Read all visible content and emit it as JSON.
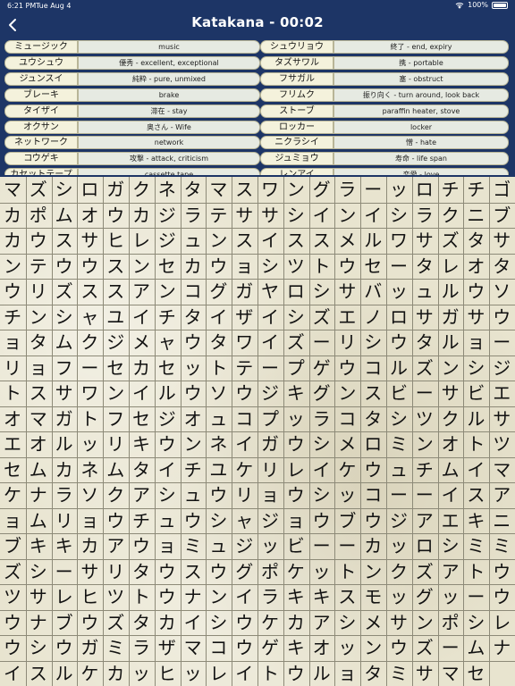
{
  "status_bar": {
    "time": "6:21 PM",
    "date": "Tue Aug 4",
    "battery": "100%"
  },
  "header": {
    "title": "Katakana - 00:02",
    "back_icon": "chevron-left-icon"
  },
  "word_list": [
    {
      "term": "ミュージック",
      "meaning": "music"
    },
    {
      "term": "シュウリョウ",
      "meaning": "終了 - end, expiry"
    },
    {
      "term": "ユウシュウ",
      "meaning": "優秀 - excellent, exceptional"
    },
    {
      "term": "タズサワル",
      "meaning": "携 - portable"
    },
    {
      "term": "ジュンスイ",
      "meaning": "純粋 - pure, unmixed"
    },
    {
      "term": "フサガル",
      "meaning": "塞 - obstruct"
    },
    {
      "term": "ブレーキ",
      "meaning": "brake"
    },
    {
      "term": "フリムク",
      "meaning": "振り向く - turn around, look back"
    },
    {
      "term": "タイザイ",
      "meaning": "滞在 - stay"
    },
    {
      "term": "ストーブ",
      "meaning": "paraffin heater, stove"
    },
    {
      "term": "オクサン",
      "meaning": "奥さん - Wife"
    },
    {
      "term": "ロッカー",
      "meaning": "locker"
    },
    {
      "term": "ネットワーク",
      "meaning": "network"
    },
    {
      "term": "ニクラシイ",
      "meaning": "憎 - hate"
    },
    {
      "term": "コウゲキ",
      "meaning": "攻撃 - attack, criticism"
    },
    {
      "term": "ジュミョウ",
      "meaning": "寿命 - life span"
    },
    {
      "term": "カセットテープ",
      "meaning": "cassette tape"
    },
    {
      "term": "レンアイ",
      "meaning": "恋愛 - love"
    }
  ],
  "grid": [
    "マズシロガクネタマスワングラーッロチチゴ",
    "カポムオウカジラテササシインイシラクニブ",
    "カウスサヒレジュンスイススメルワサズタサ",
    "ンテウウスンセカウョシツトウセータレオタ",
    "ウリズススアンコグガヤロシサバッュルウソ",
    "チンシャユイチタイザイシズエノロサガサウ",
    "ョタムクジメャウタワイズーリシウタルョー",
    "リョフーセカセットテープゲウコルズンシジ",
    "トスサワンイルウソウジキグンスビーサビエ",
    "オマガトフセジオュコプッラコタシツクルサ",
    "エオルッリキウンネイガウシメロミンオトツ",
    "セムカネムタイチユケリレイケウュチムイマ",
    "ケナラソクアシュウリョウシッコーーイスア",
    "ョムリョウチュウシャジョウブウジアエキニ",
    "ブキキカアウョミュジッビーーカッロシミミ",
    "ズシーサリタウスウグポケットンクズアトウ",
    "ツサレヒツトウナンイラキキスモッグッーウ",
    "ウナブウズタカイシウケカアシメサンポシレ",
    "ウシウガミラザマコウゲキオッンウズームナ",
    "イスルケカッヒッレイトウルョタミサマセ"
  ]
}
